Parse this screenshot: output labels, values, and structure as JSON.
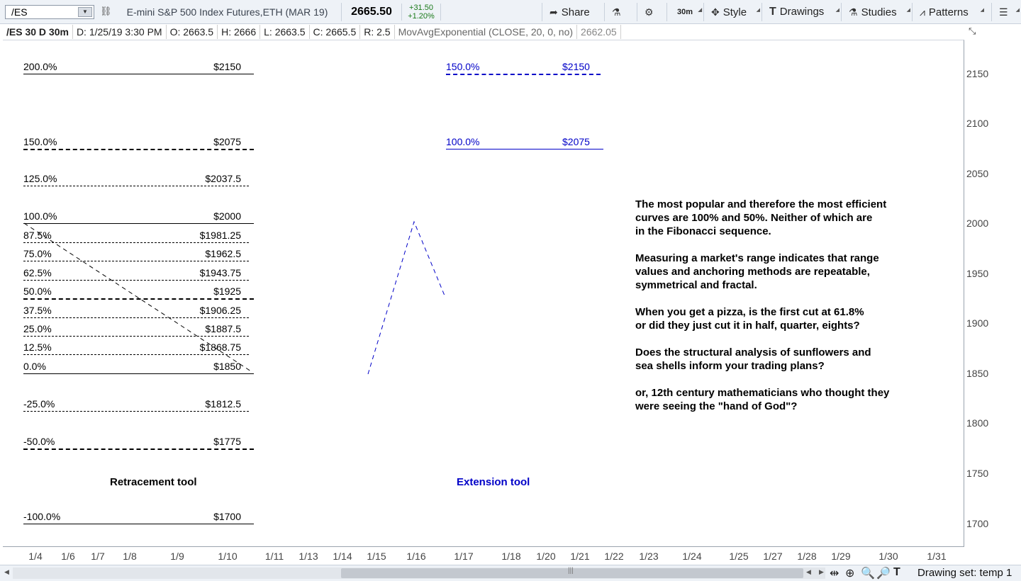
{
  "toolbar": {
    "symbol": "/ES",
    "instrument": "E-mini S&P 500 Index Futures,ETH (MAR 19)",
    "last_price": "2665.50",
    "change_abs": "+31.50",
    "change_pct": "+1.20%",
    "share": "Share",
    "timeframe": "30m",
    "style": "Style",
    "drawings": "Drawings",
    "studies": "Studies",
    "patterns": "Patterns"
  },
  "status": {
    "symbol": "/ES 30 D 30m",
    "date": "D: 1/25/19 3:30 PM",
    "open": "O: 2663.5",
    "high": "H: 2666",
    "low": "L: 2663.5",
    "close": "C: 2665.5",
    "range": "R: 2.5",
    "study": "MovAvgExponential (CLOSE, 20, 0, no)",
    "study_value": "2662.05"
  },
  "price_axis": [
    "2150",
    "2100",
    "2050",
    "2000",
    "1950",
    "1900",
    "1850",
    "1800",
    "1750",
    "1700"
  ],
  "retracement": [
    {
      "pct": "200.0%",
      "price": "$2150"
    },
    {
      "pct": "150.0%",
      "price": "$2075"
    },
    {
      "pct": "125.0%",
      "price": "$2037.5"
    },
    {
      "pct": "100.0%",
      "price": "$2000"
    },
    {
      "pct": "87.5%",
      "price": "$1981.25"
    },
    {
      "pct": "75.0%",
      "price": "$1962.5"
    },
    {
      "pct": "62.5%",
      "price": "$1943.75"
    },
    {
      "pct": "50.0%",
      "price": "$1925"
    },
    {
      "pct": "37.5%",
      "price": "$1906.25"
    },
    {
      "pct": "25.0%",
      "price": "$1887.5"
    },
    {
      "pct": "12.5%",
      "price": "$1868.75"
    },
    {
      "pct": "0.0%",
      "price": "$1850"
    },
    {
      "pct": "-25.0%",
      "price": "$1812.5"
    },
    {
      "pct": "-50.0%",
      "price": "$1775"
    },
    {
      "pct": "-100.0%",
      "price": "$1700"
    }
  ],
  "extension": [
    {
      "pct": "150.0%",
      "price": "$2150"
    },
    {
      "pct": "100.0%",
      "price": "$2075"
    }
  ],
  "labels": {
    "retracement_tool": "Retracement tool",
    "extension_tool": "Extension tool"
  },
  "note": [
    "The most popular and therefore the most efficient",
    "curves are 100% and 50%. Neither of which are",
    "in the Fibonacci sequence.",
    "",
    "Measuring a market's range indicates that range",
    "values and anchoring methods are repeatable,",
    "symmetrical and fractal.",
    "",
    "When you get a pizza, is the first cut at 61.8%",
    "or did they just cut it in half, quarter, eights?",
    "",
    "Does the structural analysis of sunflowers and",
    "sea shells inform your trading plans?",
    "",
    "or, 12th century mathematicians who thought they",
    "were seeing the \"hand of God\"?"
  ],
  "date_axis": [
    "1/4",
    "1/6",
    "1/7",
    "1/8",
    "1/9",
    "1/10",
    "1/11",
    "1/13",
    "1/14",
    "1/15",
    "1/16",
    "1/17",
    "1/18",
    "1/20",
    "1/21",
    "1/22",
    "1/23",
    "1/24",
    "1/25",
    "1/27",
    "1/28",
    "1/29",
    "1/30",
    "1/31"
  ],
  "bottom": {
    "drawing_set": "Drawing set: temp 1"
  },
  "colors": {
    "extension": "#0000c8",
    "toolbar_bg": "#eef2f7",
    "change_up": "#1a7a1a"
  }
}
